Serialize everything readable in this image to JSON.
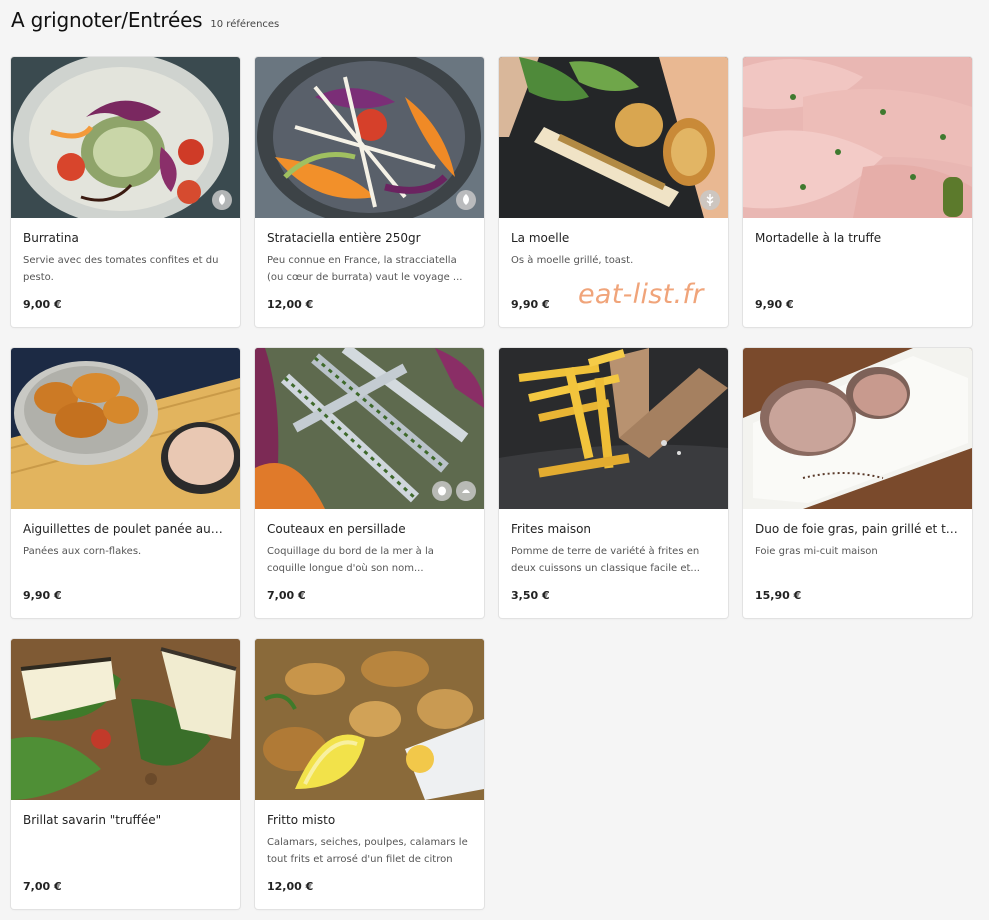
{
  "header": {
    "title": "A grignoter/Entrées",
    "count": "10 références"
  },
  "watermark": "eat-list.fr",
  "items": [
    {
      "name": "Burratina",
      "description": "Servie avec des tomates confites et du pesto.",
      "price": "9,00 €",
      "badge": "vegetarian-icon"
    },
    {
      "name": "Strataciella entière 250gr",
      "description": "Peu connue en France, la stracciatella (ou cœur de burrata) vaut le voyage ...",
      "price": "12,00 €",
      "badge": "vegetarian-icon"
    },
    {
      "name": "La moelle",
      "description": "Os à moelle grillé, toast.",
      "price": "9,90 €",
      "badge": "gluten-icon"
    },
    {
      "name": "Mortadelle à la truffe",
      "description": "",
      "price": "9,90 €"
    },
    {
      "name": "Aiguillettes de poulet panée aux...",
      "description": "Panées aux corn-flakes.",
      "price": "9,90 €"
    },
    {
      "name": "Couteaux en persillade",
      "description": "Coquillage du bord de la mer à la coquille longue d'où son nom...",
      "price": "7,00 €"
    },
    {
      "name": "Frites maison",
      "description": "Pomme de terre de variété à frites en deux cuissons un classique facile et...",
      "price": "3,50 €"
    },
    {
      "name": "Duo de foie gras, pain grillé et tr...",
      "description": "Foie gras mi-cuit maison",
      "price": "15,90 €"
    },
    {
      "name": "Brillat savarin \"truffée\"",
      "description": "",
      "price": "7,00 €"
    },
    {
      "name": "Fritto misto",
      "description": "Calamars, seiches, poulpes, calamars le tout frits et arrosé d'un filet de citron",
      "price": "12,00 €"
    }
  ],
  "colors": {
    "background": "#f5f5f5",
    "card": "#ffffff",
    "watermark": "#f0a47a"
  }
}
